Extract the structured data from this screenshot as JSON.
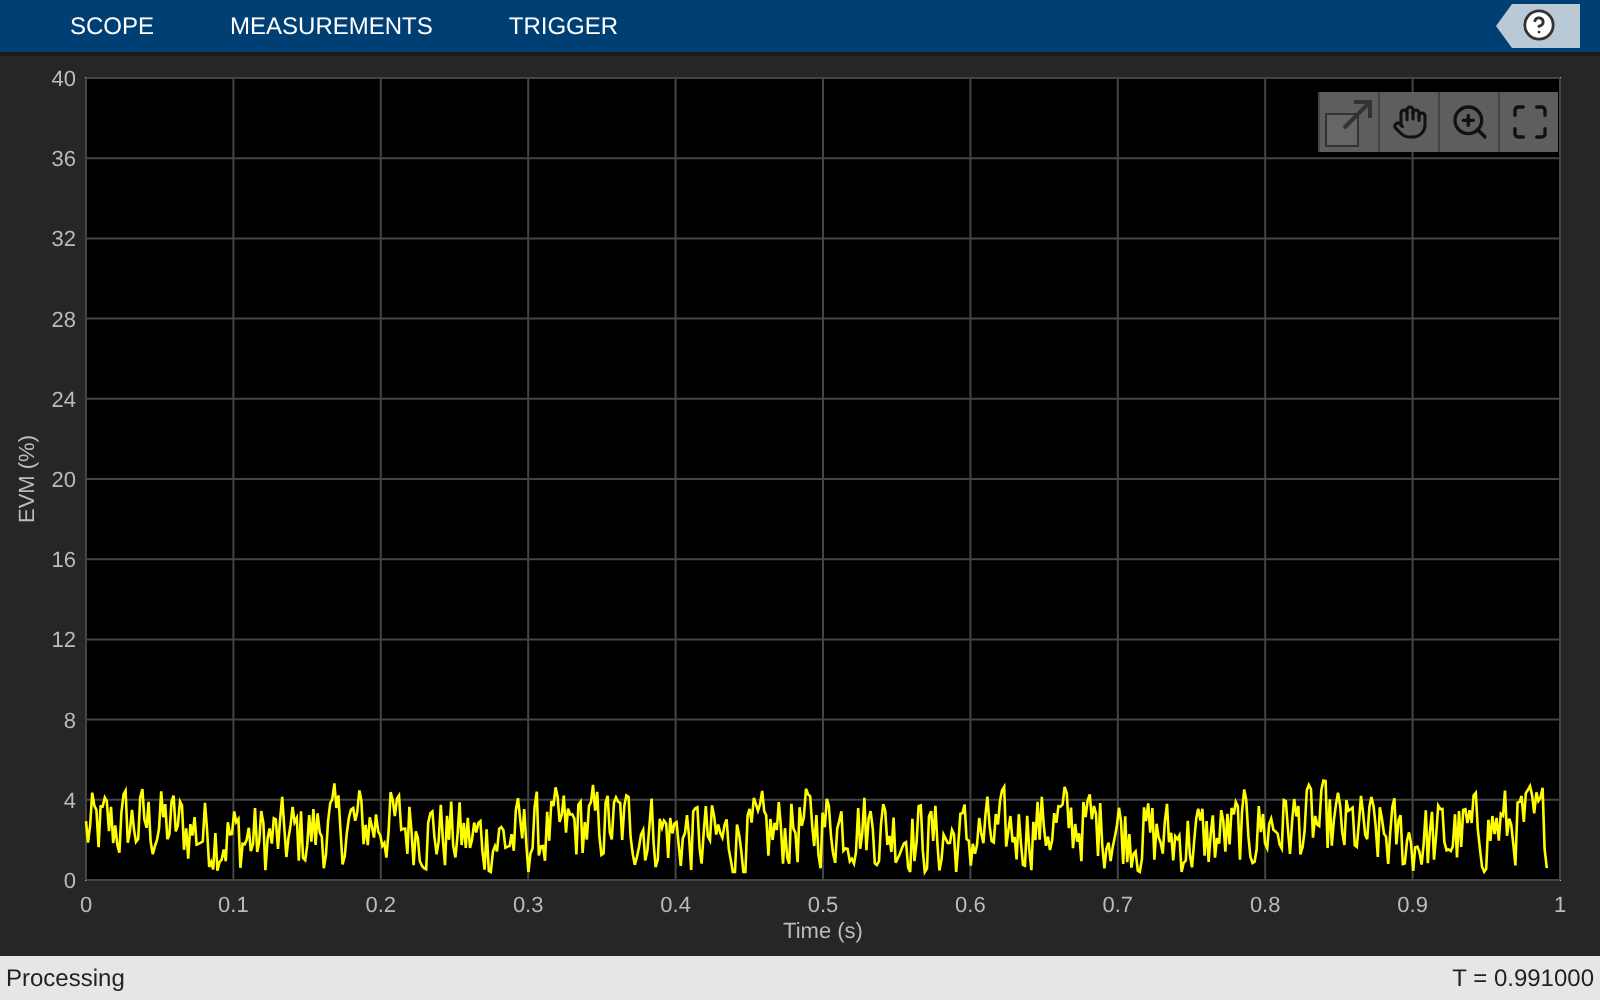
{
  "toolstrip": {
    "tabs": [
      {
        "label": "SCOPE"
      },
      {
        "label": "MEASUREMENTS"
      },
      {
        "label": "TRIGGER"
      }
    ]
  },
  "plot": {
    "ylabel": "EVM (%)",
    "xlabel": "Time (s)",
    "yticks": [
      "40",
      "36",
      "32",
      "28",
      "24",
      "20",
      "16",
      "12",
      "8",
      "4",
      "0"
    ],
    "xticks": [
      "0",
      "0.1",
      "0.2",
      "0.3",
      "0.4",
      "0.5",
      "0.6",
      "0.7",
      "0.8",
      "0.9",
      "1"
    ]
  },
  "status_bar": {
    "state": "Processing",
    "time": "T = 0.991000"
  }
}
